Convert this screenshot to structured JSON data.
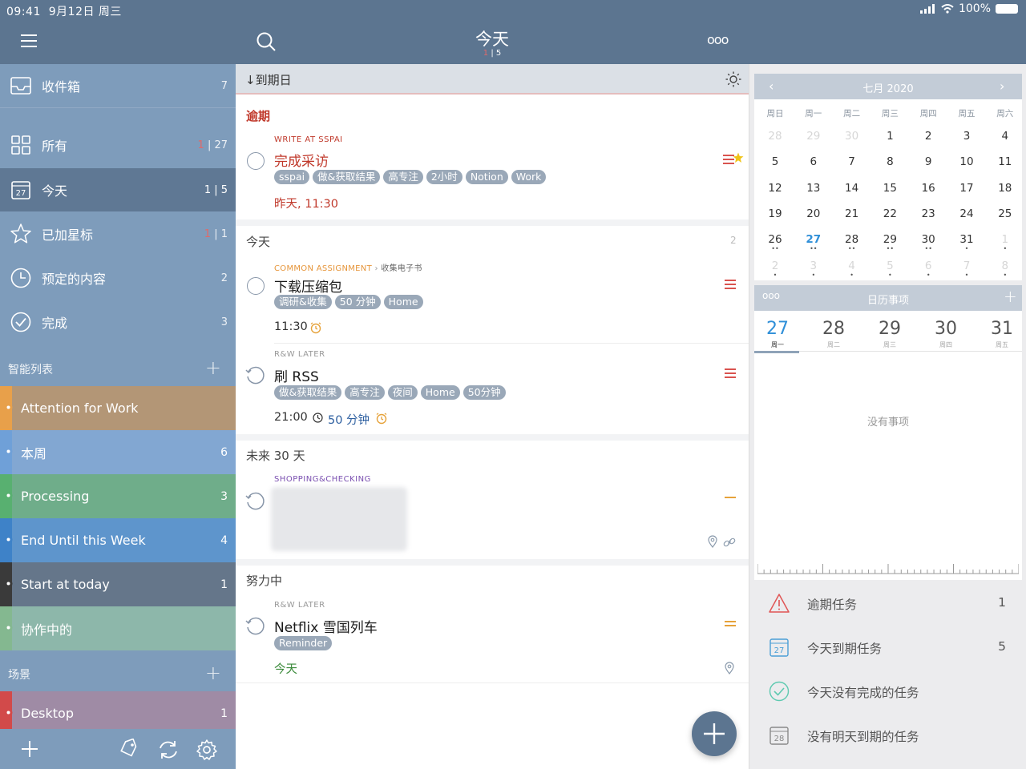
{
  "status": {
    "time": "09:41",
    "date": "9月12日 周三",
    "battery": "100%"
  },
  "header": {
    "title": "今天",
    "subtitle_red": "1",
    "subtitle_rest": "| 5",
    "more": "ooo"
  },
  "sidebar": {
    "nav": [
      {
        "label": "收件箱",
        "count_red": "",
        "count": "7",
        "icon": "inbox-icon"
      },
      {
        "label": "所有",
        "count_red": "1",
        "count": "| 27",
        "icon": "grid-icon"
      },
      {
        "label": "今天",
        "count_red": "",
        "count": "1 | 5",
        "icon": "calendar-27-icon",
        "icon_text": "27"
      },
      {
        "label": "已加星标",
        "count_red": "1",
        "count": "| 1",
        "icon": "star-icon"
      },
      {
        "label": "预定的内容",
        "count_red": "",
        "count": "2",
        "icon": "clock-icon"
      },
      {
        "label": "完成",
        "count_red": "",
        "count": "3",
        "icon": "check-circle-icon"
      }
    ],
    "smart_header": "智能列表",
    "smart_lists": [
      {
        "label": "Attention for Work",
        "count": "",
        "color": "#b39676",
        "stripe": "#e8a04a"
      },
      {
        "label": "本周",
        "count": "6",
        "color": "#82a7d2",
        "stripe": "#6fa0d8"
      },
      {
        "label": "Processing",
        "count": "3",
        "color": "#6fad8a",
        "stripe": "#58b070"
      },
      {
        "label": "End Until this Week",
        "count": "4",
        "color": "#5e95cc",
        "stripe": "#3e82c8"
      },
      {
        "label": "Start at today",
        "count": "1",
        "color": "#65768a",
        "stripe": "#3a3a3a"
      },
      {
        "label": "协作中的",
        "count": "",
        "color": "#8db7aa",
        "stripe": "#84b890"
      }
    ],
    "context_header": "场景",
    "contexts": [
      {
        "label": "Desktop",
        "count": "1",
        "color": "#9f8ba5",
        "stripe": "#d24a4a"
      }
    ]
  },
  "main": {
    "sort_label": "到期日",
    "groups": {
      "overdue": "逾期",
      "today": "今天",
      "today_count": "2",
      "next30": "未来 30 天",
      "working": "努力中"
    },
    "tasks": [
      {
        "project": "WRITE AT SSPAI",
        "title": "完成采访",
        "tags": [
          "sspai",
          "做&获取结果",
          "高专注",
          "2小时",
          "Notion",
          "Work"
        ],
        "due": "昨天, 11:30"
      },
      {
        "project": "COMMON ASSIGNMENT",
        "subproject": "收集电子书",
        "title": "下载压缩包",
        "tags": [
          "调研&收集",
          "50 分钟",
          "Home"
        ],
        "due": "11:30"
      },
      {
        "project": "R&W LATER",
        "title": "刷 RSS",
        "tags": [
          "做&获取结果",
          "高专注",
          "夜间",
          "Home",
          "50分钟"
        ],
        "due": "21:00",
        "duration": "50 分钟"
      },
      {
        "project": "SHOPPING&CHECKING",
        "title": ""
      },
      {
        "project": "R&W LATER",
        "title": "Netflix 雪国列车",
        "tags": [
          "Reminder"
        ],
        "due": "今天"
      }
    ]
  },
  "calendar": {
    "month": "七月 2020",
    "weekdays": [
      "周日",
      "周一",
      "周二",
      "周三",
      "周四",
      "周五",
      "周六"
    ],
    "weeks": [
      [
        "28",
        "29",
        "30",
        "1",
        "2",
        "3",
        "4"
      ],
      [
        "5",
        "6",
        "7",
        "8",
        "9",
        "10",
        "11"
      ],
      [
        "12",
        "13",
        "14",
        "15",
        "16",
        "17",
        "18"
      ],
      [
        "19",
        "20",
        "21",
        "22",
        "23",
        "24",
        "25"
      ],
      [
        "26",
        "27",
        "28",
        "29",
        "30",
        "31",
        "1"
      ],
      [
        "2",
        "3",
        "4",
        "5",
        "6",
        "7",
        "8"
      ]
    ]
  },
  "agenda": {
    "more": "ooo",
    "title": "日历事项",
    "days": [
      {
        "n": "27",
        "w": "周一"
      },
      {
        "n": "28",
        "w": "周二"
      },
      {
        "n": "29",
        "w": "周三"
      },
      {
        "n": "30",
        "w": "周四"
      },
      {
        "n": "31",
        "w": "周五"
      }
    ],
    "empty": "没有事项"
  },
  "quick": [
    {
      "label": "逾期任务",
      "count": "1",
      "icon": "warning-icon"
    },
    {
      "label": "今天到期任务",
      "count": "5",
      "icon": "calendar-27-icon",
      "icon_text": "27"
    },
    {
      "label": "今天没有完成的任务",
      "count": "",
      "icon": "check-circle-icon"
    },
    {
      "label": "没有明天到期的任务",
      "count": "",
      "icon": "calendar-28-icon",
      "icon_text": "28"
    }
  ],
  "colors": {
    "accent": "#5c7590",
    "overdue": "#c0392b",
    "sidebar": "#7e9cbb",
    "priority": "#d9534f"
  }
}
